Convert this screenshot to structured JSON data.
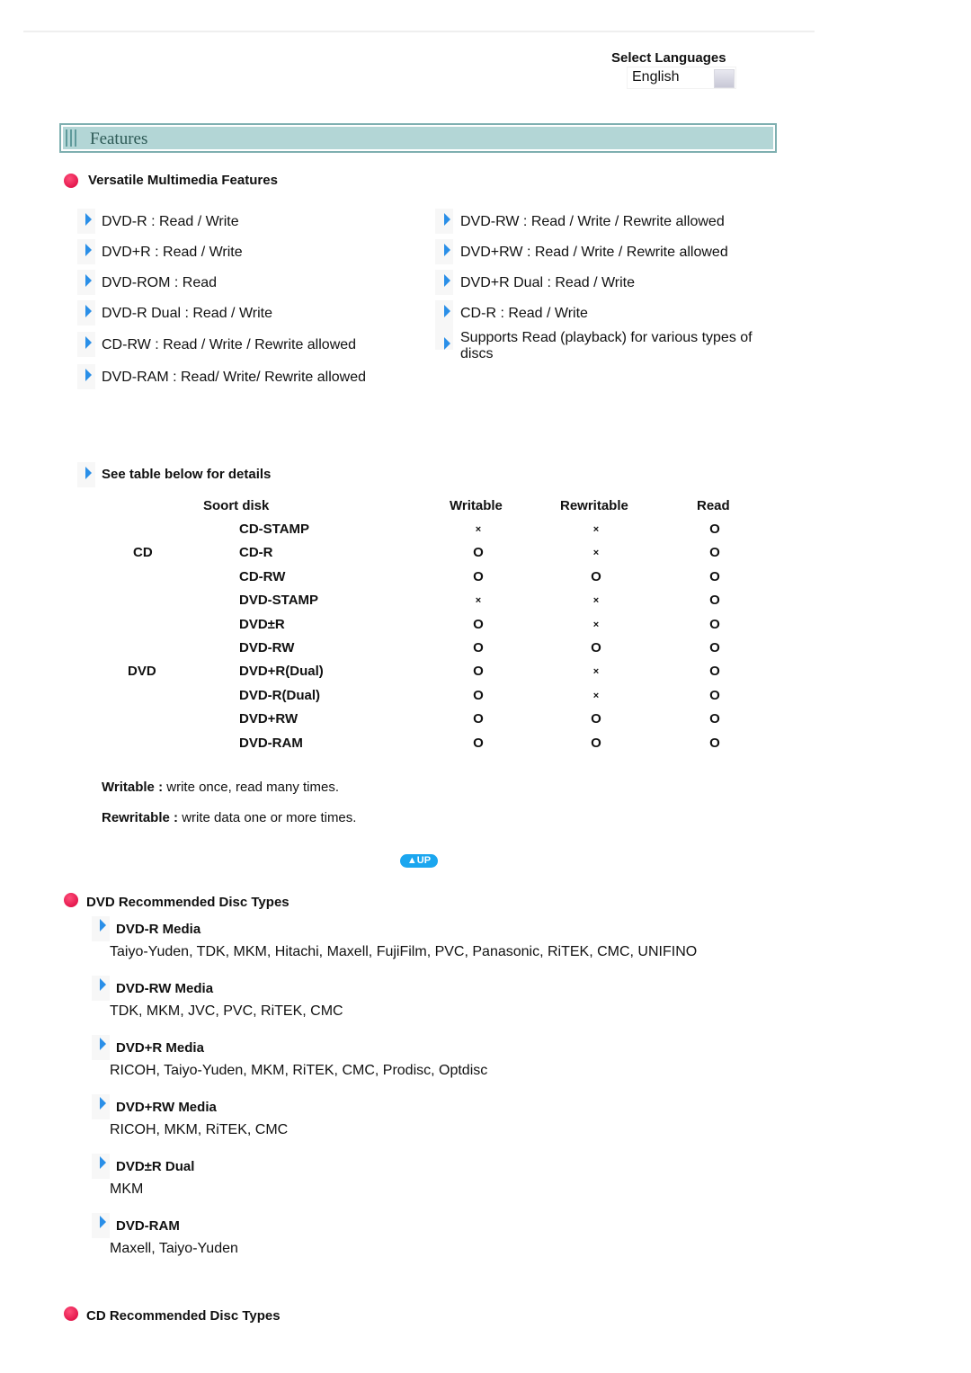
{
  "language": {
    "label": "Select Languages",
    "selected": "English"
  },
  "banner": {
    "title": "Features"
  },
  "versatile": {
    "title": "Versatile Multimedia Features",
    "left": [
      "DVD-R : Read / Write",
      "DVD+R : Read / Write",
      "DVD-ROM : Read",
      "DVD-R Dual : Read / Write",
      "CD-RW : Read / Write / Rewrite allowed",
      "DVD-RAM : Read/ Write/ Rewrite allowed"
    ],
    "right": [
      "DVD-RW : Read / Write / Rewrite allowed",
      "DVD+RW : Read / Write / Rewrite allowed",
      "DVD+R Dual : Read / Write",
      "CD-R : Read / Write",
      "Supports Read (playback) for various types of discs"
    ]
  },
  "table": {
    "intro": "See table below for details",
    "headers": {
      "sort": "Soort disk",
      "writable": "Writable",
      "rewritable": "Rewritable",
      "read": "Read"
    },
    "groups": [
      {
        "label": "CD",
        "row": 1
      },
      {
        "label": "DVD",
        "row": 6
      }
    ],
    "rows": [
      {
        "disk": "CD-STAMP",
        "writable": "×",
        "rewritable": "×",
        "read": "O"
      },
      {
        "disk": "CD-R",
        "writable": "O",
        "rewritable": "×",
        "read": "O"
      },
      {
        "disk": "CD-RW",
        "writable": "O",
        "rewritable": "O",
        "read": "O"
      },
      {
        "disk": "DVD-STAMP",
        "writable": "×",
        "rewritable": "×",
        "read": "O"
      },
      {
        "disk": "DVD±R",
        "writable": "O",
        "rewritable": "×",
        "read": "O"
      },
      {
        "disk": "DVD-RW",
        "writable": "O",
        "rewritable": "O",
        "read": "O"
      },
      {
        "disk": "DVD+R(Dual)",
        "writable": "O",
        "rewritable": "×",
        "read": "O"
      },
      {
        "disk": "DVD-R(Dual)",
        "writable": "O",
        "rewritable": "×",
        "read": "O"
      },
      {
        "disk": "DVD+RW",
        "writable": "O",
        "rewritable": "O",
        "read": "O"
      },
      {
        "disk": "DVD-RAM",
        "writable": "O",
        "rewritable": "O",
        "read": "O"
      }
    ]
  },
  "notes": {
    "writable_term": "Writable :",
    "writable_def": " write once, read many times.",
    "rewritable_term": "Rewritable :",
    "rewritable_def": " write data one or more times."
  },
  "up_button": "▲UP",
  "dvd_recommended": {
    "title": "DVD Recommended Disc Types",
    "media": [
      {
        "title": "DVD-R Media",
        "brands": "Taiyo-Yuden, TDK, MKM, Hitachi, Maxell, FujiFilm, PVC, Panasonic, RiTEK, CMC, UNIFINO"
      },
      {
        "title": "DVD-RW Media",
        "brands": "TDK, MKM, JVC, PVC, RiTEK, CMC"
      },
      {
        "title": "DVD+R Media",
        "brands": "RICOH, Taiyo-Yuden, MKM, RiTEK, CMC, Prodisc, Optdisc"
      },
      {
        "title": "DVD+RW Media",
        "brands": "RICOH, MKM, RiTEK, CMC"
      },
      {
        "title": "DVD±R Dual",
        "brands": "MKM"
      },
      {
        "title": "DVD-RAM",
        "brands": "Maxell, Taiyo-Yuden"
      }
    ]
  },
  "cd_recommended": {
    "title": "CD Recommended Disc Types"
  }
}
